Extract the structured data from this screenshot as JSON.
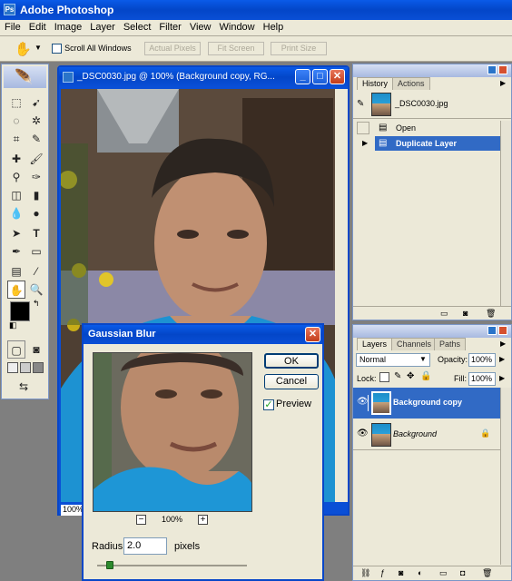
{
  "app": {
    "title": "Adobe Photoshop"
  },
  "menu": [
    "File",
    "Edit",
    "Image",
    "Layer",
    "Select",
    "Filter",
    "View",
    "Window",
    "Help"
  ],
  "options_bar": {
    "scroll_all": "Scroll All Windows",
    "actual_pixels": "Actual Pixels",
    "fit_screen": "Fit Screen",
    "print_size": "Print Size"
  },
  "document": {
    "title": "_DSC0030.jpg @ 100% (Background copy, RG...",
    "zoom": "100%"
  },
  "dialog": {
    "title": "Gaussian Blur",
    "ok": "OK",
    "cancel": "Cancel",
    "preview": "Preview",
    "preview_checked": true,
    "zoom": "100%",
    "radius_label": "Radius:",
    "radius_value": "2.0",
    "radius_unit": "pixels",
    "slider_level": 0.07
  },
  "history": {
    "tabs": [
      "History",
      "Actions"
    ],
    "snapshot": "_DSC0030.jpg",
    "items": [
      "Open",
      "Duplicate Layer"
    ]
  },
  "layers": {
    "tabs": [
      "Layers",
      "Channels",
      "Paths"
    ],
    "blend_mode": "Normal",
    "opacity_label": "Opacity:",
    "opacity": "100%",
    "lock_label": "Lock:",
    "fill_label": "Fill:",
    "fill": "100%",
    "items": [
      {
        "name": "Background copy",
        "selected": true
      },
      {
        "name": "Background",
        "selected": false
      }
    ]
  },
  "colors": {
    "title_blue": "#0a4fd6",
    "select_blue": "#316ac5",
    "panel_bg": "#ece9d8"
  }
}
